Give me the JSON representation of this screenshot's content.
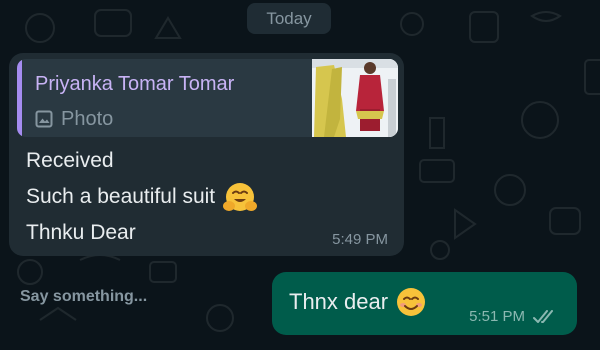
{
  "chat": {
    "date_chip": "Today",
    "incoming": {
      "quote": {
        "author": "Priyanka Tomar Tomar",
        "type_label": "Photo",
        "type_icon": "image-icon"
      },
      "lines": [
        "Received",
        "Such a beautiful suit",
        "Thnku Dear"
      ],
      "time": "5:49 PM"
    },
    "input": {
      "placeholder": "Say something..."
    },
    "outgoing": {
      "text": "Thnx dear",
      "time": "5:51 PM",
      "status_icon": "double-check-icon"
    }
  },
  "colors": {
    "background": "#0b141a",
    "incoming_bubble": "#202c33",
    "outgoing_bubble": "#005c4b",
    "quote_accent": "#a58cf0"
  }
}
